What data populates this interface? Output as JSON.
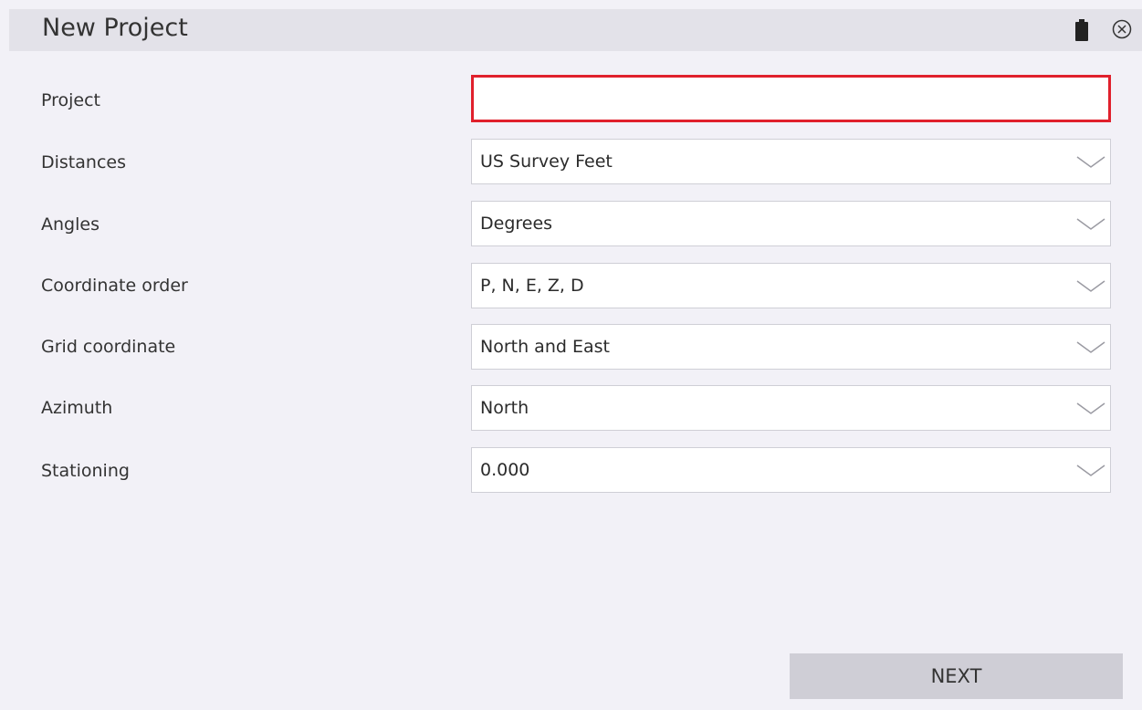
{
  "window": {
    "title": "New Project"
  },
  "icons": {
    "battery": "battery-icon",
    "close": "close-icon"
  },
  "form": {
    "project": {
      "label": "Project",
      "value": "",
      "placeholder": ""
    },
    "distances": {
      "label": "Distances",
      "value": "US Survey Feet"
    },
    "angles": {
      "label": "Angles",
      "value": "Degrees"
    },
    "coordinate_order": {
      "label": "Coordinate order",
      "value": "P, N, E, Z, D"
    },
    "grid_coordinate": {
      "label": "Grid coordinate",
      "value": "North and East"
    },
    "azimuth": {
      "label": "Azimuth",
      "value": "North"
    },
    "stationing": {
      "label": "Stationing",
      "value": "0.000"
    }
  },
  "actions": {
    "next_label": "NEXT"
  },
  "colors": {
    "background": "#f2f1f7",
    "titlebar": "#e3e2e9",
    "error_border": "#e0202c",
    "button": "#cfced6"
  }
}
